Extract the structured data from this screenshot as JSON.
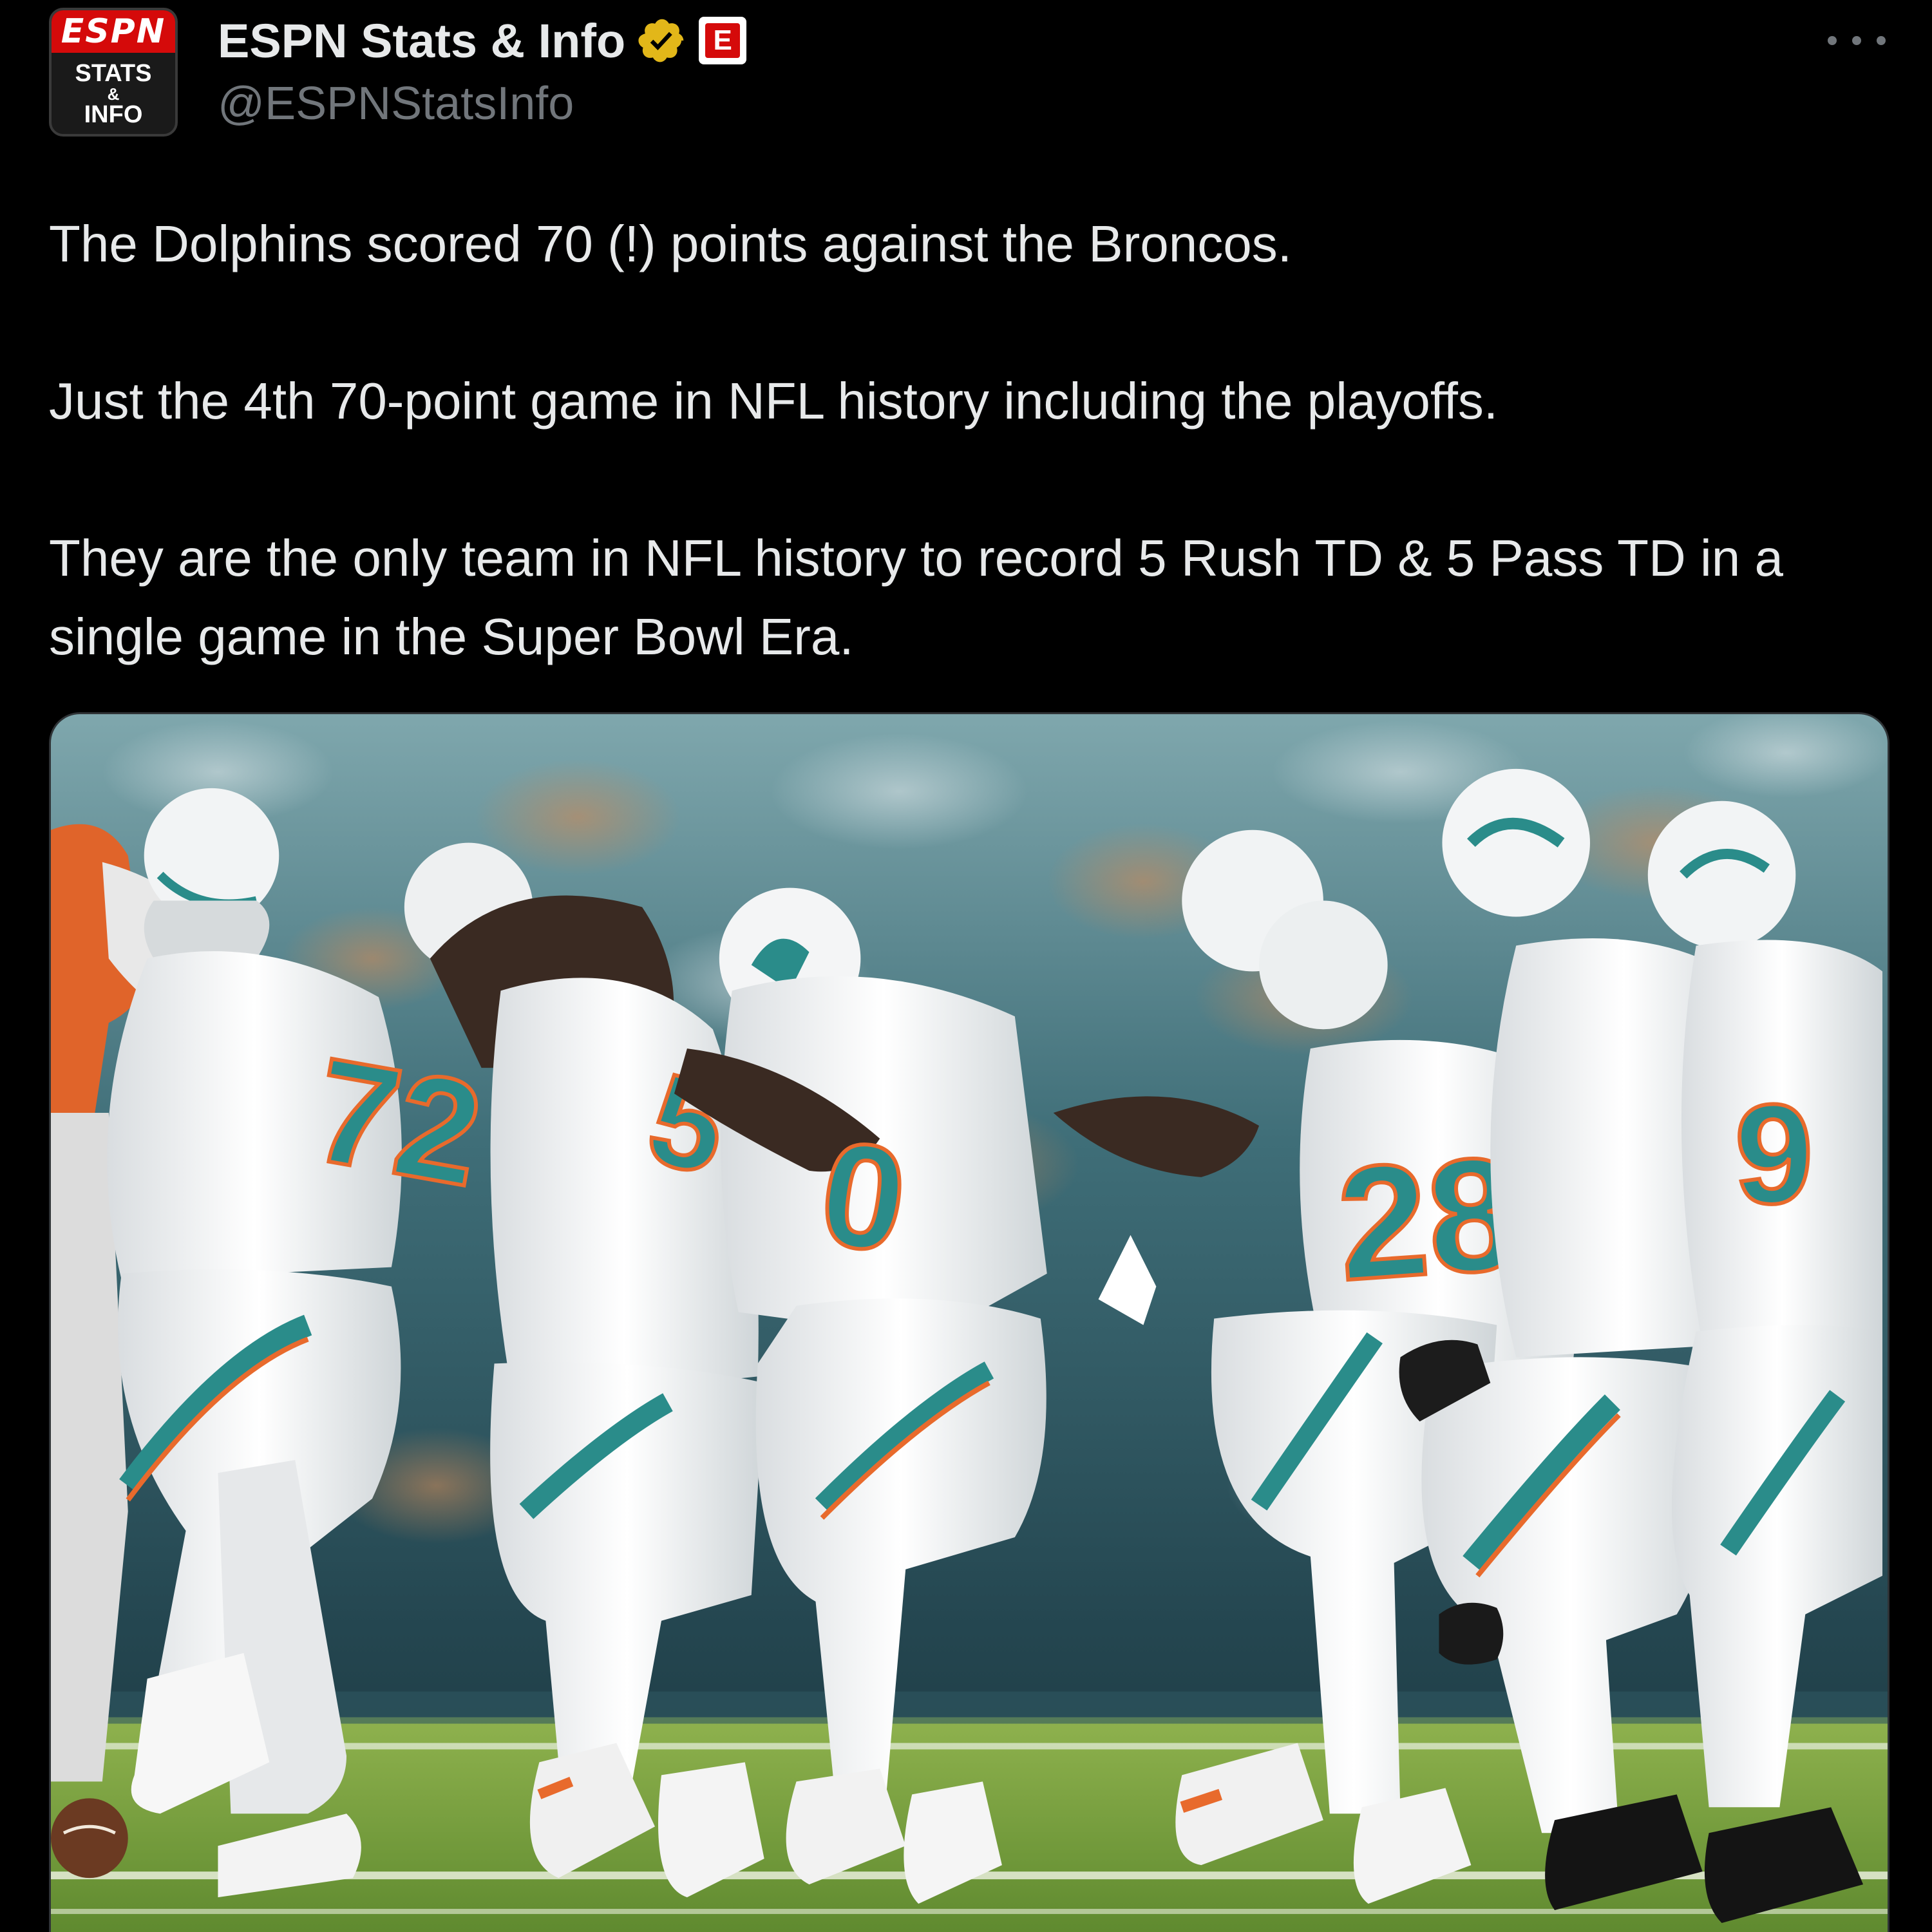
{
  "author": {
    "display_name": "ESPN Stats & Info",
    "handle": "@ESPNStatsInfo",
    "avatar_logo_text": "ESPN",
    "avatar_line1": "STATS",
    "avatar_line2": "&",
    "avatar_line3": "INFO",
    "verified_badge_icon": "gold-verified-badge",
    "affiliate_badge_letter": "E"
  },
  "more_menu_icon": "ellipsis-icon",
  "tweet": {
    "paragraphs": [
      "The Dolphins scored 70 (!) points against the Broncos.",
      "Just the 4th 70-point game in NFL history including the playoffs.",
      "They are the only team in NFL history to record 5 Rush TD & 5 Pass TD in a single game in the Super Bowl Era."
    ]
  },
  "media": {
    "jersey_numbers": [
      "72",
      "0",
      "28",
      "9"
    ]
  },
  "colors": {
    "background": "#000000",
    "text_primary": "#e7e9ea",
    "text_secondary": "#71767b",
    "verified_gold": "#e2b719",
    "espn_red": "#d50a0a",
    "dolphins_aqua": "#2a8c8a",
    "dolphins_orange": "#e86a2c",
    "field_green": "#6f9a3a"
  }
}
